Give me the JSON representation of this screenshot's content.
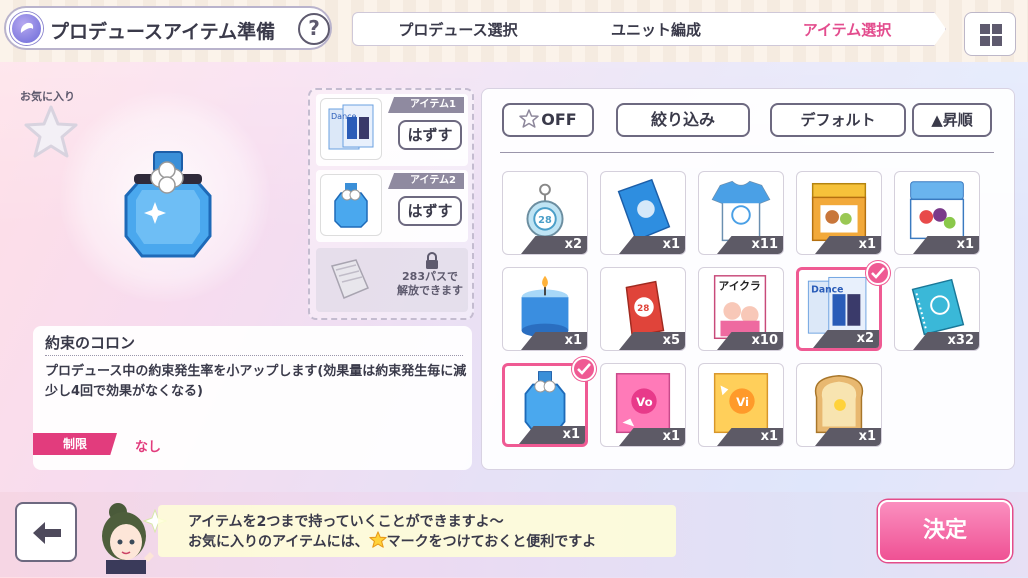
{
  "header": {
    "title": "プロデュースアイテム準備",
    "help_label": "?",
    "steps": [
      "プロデュース選択",
      "ユニット編成",
      "アイテム選択"
    ],
    "active_step": 2
  },
  "favorite": {
    "label": "お気に入り"
  },
  "selected_item": {
    "name": "約束のコロン",
    "description": "プロデュース中の約束発生率を小アップします(効果量は約束発生毎に減少し4回で効果がなくなる)",
    "limit_label": "制限",
    "limit_value": "なし"
  },
  "equip": {
    "slots": [
      {
        "badge": "アイテム1",
        "button": "はずす",
        "icon": "dance-magazine-icon"
      },
      {
        "badge": "アイテム2",
        "button": "はずす",
        "icon": "perfume-bottle-icon"
      }
    ],
    "locked_text": "283パスで\n解放できます"
  },
  "inventory": {
    "fav_toggle": "OFF",
    "filter": "絞り込み",
    "sort": "デフォルト",
    "order": "▲昇順",
    "items": [
      {
        "icon": "keychain-icon",
        "qty": "x2",
        "selected": false
      },
      {
        "icon": "towel-icon",
        "qty": "x1",
        "selected": false
      },
      {
        "icon": "tshirt-icon",
        "qty": "x11",
        "selected": false
      },
      {
        "icon": "bento-box-icon",
        "qty": "x1",
        "selected": false
      },
      {
        "icon": "lunch-box-icon",
        "qty": "x1",
        "selected": false
      },
      {
        "icon": "candle-icon",
        "qty": "x1",
        "selected": false
      },
      {
        "icon": "omamori-charm-icon",
        "qty": "x5",
        "selected": false
      },
      {
        "icon": "idol-magazine-icon",
        "qty": "x10",
        "selected": false
      },
      {
        "icon": "dance-magazine-icon",
        "qty": "x2",
        "selected": true
      },
      {
        "icon": "notebook-icon",
        "qty": "x32",
        "selected": false
      },
      {
        "icon": "perfume-bottle-icon",
        "qty": "x1",
        "selected": true
      },
      {
        "icon": "vocal-book-icon",
        "qty": "x1",
        "selected": false
      },
      {
        "icon": "visual-book-icon",
        "qty": "x1",
        "selected": false
      },
      {
        "icon": "toast-icon",
        "qty": "x1",
        "selected": false
      }
    ]
  },
  "footer": {
    "message_line1": "アイテムを2つまで持っていくことができますよ～",
    "message_line2_a": "お気に入りのアイテムには、",
    "message_line2_b": "マークをつけておくと便利ですよ",
    "confirm": "決定"
  },
  "colors": {
    "accent_pink": "#ef5a93",
    "limit_red": "#e23c7d",
    "active_step": "#e34d8e"
  }
}
